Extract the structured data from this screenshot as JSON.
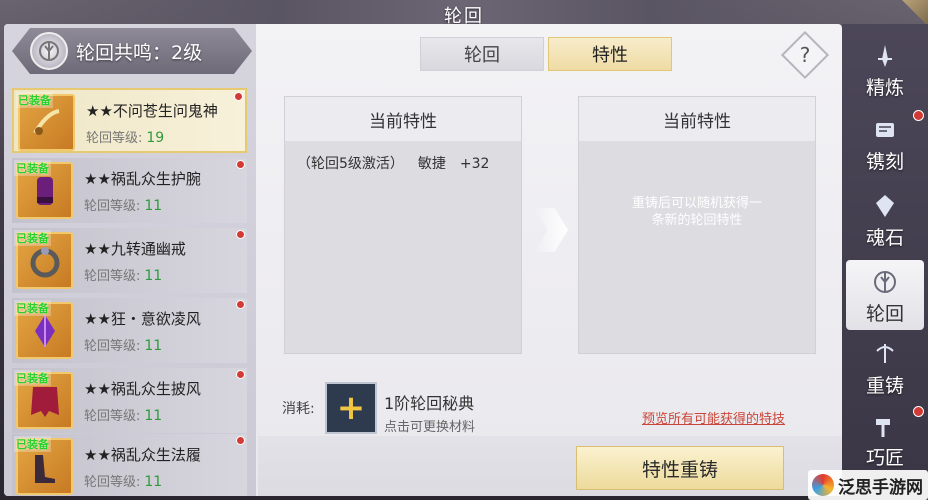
{
  "window": {
    "title": "轮回"
  },
  "resonance": {
    "label": "轮回共鸣：2级"
  },
  "items": [
    {
      "badge": "已装备",
      "name": "★★不问苍生问鬼神",
      "level_label": "轮回等级:",
      "level": "19",
      "selected": true,
      "dot": true
    },
    {
      "badge": "已装备",
      "name": "★★祸乱众生护腕",
      "level_label": "轮回等级:",
      "level": "11",
      "selected": false,
      "dot": true
    },
    {
      "badge": "已装备",
      "name": "★★九转通幽戒",
      "level_label": "轮回等级:",
      "level": "11",
      "selected": false,
      "dot": true
    },
    {
      "badge": "已装备",
      "name": "★★狂・意欲凌风",
      "level_label": "轮回等级:",
      "level": "11",
      "selected": false,
      "dot": true
    },
    {
      "badge": "已装备",
      "name": "★★祸乱众生披风",
      "level_label": "轮回等级:",
      "level": "11",
      "selected": false,
      "dot": true
    },
    {
      "badge": "已装备",
      "name": "★★祸乱众生法履",
      "level_label": "轮回等级:",
      "level": "11",
      "selected": false,
      "dot": true
    }
  ],
  "tabs": {
    "lunhui": "轮回",
    "texing": "特性"
  },
  "help": {
    "glyph": "?"
  },
  "current_left": {
    "title": "当前特性",
    "cond": "（轮回5级激活）",
    "attr": "敏捷",
    "value": "+32"
  },
  "current_right": {
    "title": "当前特性",
    "note_line1": "重铸后可以随机获得一",
    "note_line2": "条新的轮回特性"
  },
  "consume": {
    "label": "消耗:",
    "material_name": "1阶轮回秘典",
    "material_hint": "点击可更换材料",
    "preview_link": "预览所有可能获得的特技"
  },
  "reforge_button": "特性重铸",
  "nav": [
    {
      "label": "精炼",
      "icon": "sword-icon",
      "active": false,
      "dot": false
    },
    {
      "label": "镌刻",
      "icon": "engrave-icon",
      "active": false,
      "dot": true
    },
    {
      "label": "魂石",
      "icon": "soulstone-icon",
      "active": false,
      "dot": false
    },
    {
      "label": "轮回",
      "icon": "reincarnation-icon",
      "active": true,
      "dot": false
    },
    {
      "label": "重铸",
      "icon": "reforge-icon",
      "active": false,
      "dot": false
    },
    {
      "label": "巧匠",
      "icon": "craftsman-icon",
      "active": false,
      "dot": true
    }
  ],
  "watermark": {
    "text": "泛思手游网"
  }
}
